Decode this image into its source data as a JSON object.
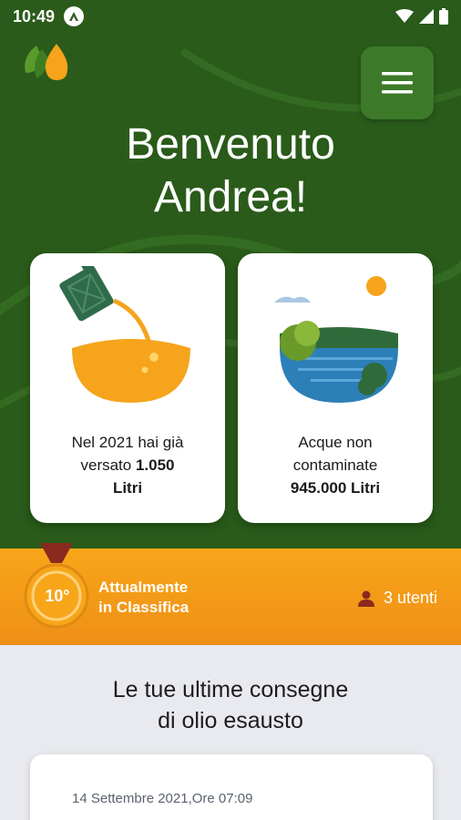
{
  "status_bar": {
    "time": "10:49"
  },
  "header": {
    "welcome_line1": "Benvenuto",
    "welcome_line2": "Andrea!"
  },
  "cards": {
    "oil": {
      "line1": "Nel 2021 hai già",
      "line2_prefix": "versato ",
      "line2_value": "1.050",
      "line3": "Litri"
    },
    "water": {
      "line1": "Acque non",
      "line2": "contaminate",
      "value": "945.000 Litri"
    }
  },
  "ranking": {
    "position": "10°",
    "label_line1": "Attualmente",
    "label_line2": "in Classifica",
    "users": "3 utenti"
  },
  "deliveries": {
    "title_line1": "Le tue ultime consegne",
    "title_line2": "di olio esausto",
    "items": [
      {
        "date": "14 Settembre 2021,Ore 07:09"
      }
    ]
  },
  "colors": {
    "header_green": "#2a5b1a",
    "menu_green": "#3c7a2a",
    "orange": "#f7a61a",
    "background": "#e9eaef"
  }
}
